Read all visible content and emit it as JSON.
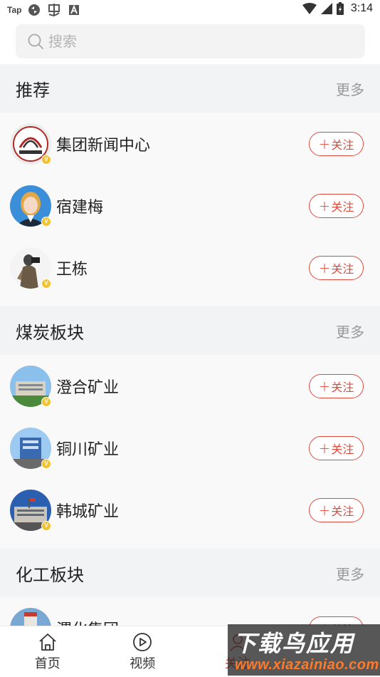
{
  "status_bar": {
    "carrier_badge": "Tap",
    "time": "3:14"
  },
  "search": {
    "placeholder": "搜索"
  },
  "sections": [
    {
      "title": "推荐",
      "more": "更多",
      "items": [
        {
          "name": "集团新闻中心",
          "avatar": "logo",
          "follow": "关注"
        },
        {
          "name": "宿建梅",
          "avatar": "person",
          "follow": "关注"
        },
        {
          "name": "王栋",
          "avatar": "photographer",
          "follow": "关注"
        }
      ]
    },
    {
      "title": "煤炭板块",
      "more": "更多",
      "items": [
        {
          "name": "澄合矿业",
          "avatar": "building",
          "follow": "关注"
        },
        {
          "name": "铜川矿业",
          "avatar": "building",
          "follow": "关注"
        },
        {
          "name": "韩城矿业",
          "avatar": "building",
          "follow": "关注"
        }
      ]
    },
    {
      "title": "化工板块",
      "more": "更多",
      "items": [
        {
          "name": "渭化集团",
          "avatar": "tower",
          "follow": "关注"
        }
      ]
    }
  ],
  "bottom_nav": [
    {
      "label": "首页",
      "icon": "home-icon"
    },
    {
      "label": "视频",
      "icon": "play-icon"
    },
    {
      "label": "关注",
      "icon": "follow-icon",
      "active": true
    }
  ],
  "watermark": {
    "line1": "下载鸟应用",
    "line2": "www.xiazainiao.com"
  },
  "colors": {
    "accent": "#e04a3c",
    "verified_badge": "#f2c230",
    "section_bg": "#f2f3f5"
  }
}
